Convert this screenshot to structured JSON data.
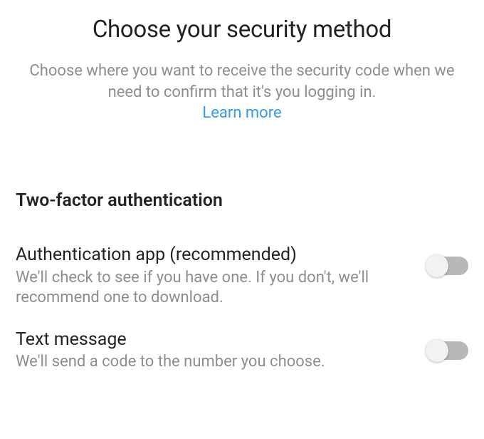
{
  "header": {
    "title": "Choose your security method",
    "description": "Choose where you want to receive the security code when we need to confirm that it's you logging in.",
    "learn_more_label": "Learn more"
  },
  "section": {
    "heading": "Two-factor authentication",
    "options": [
      {
        "title": "Authentication app (recommended)",
        "description": "We'll check to see if you have one. If you don't, we'll recommend one to download.",
        "enabled": false
      },
      {
        "title": "Text message",
        "description": "We'll send a code to the number you choose.",
        "enabled": false
      }
    ]
  }
}
